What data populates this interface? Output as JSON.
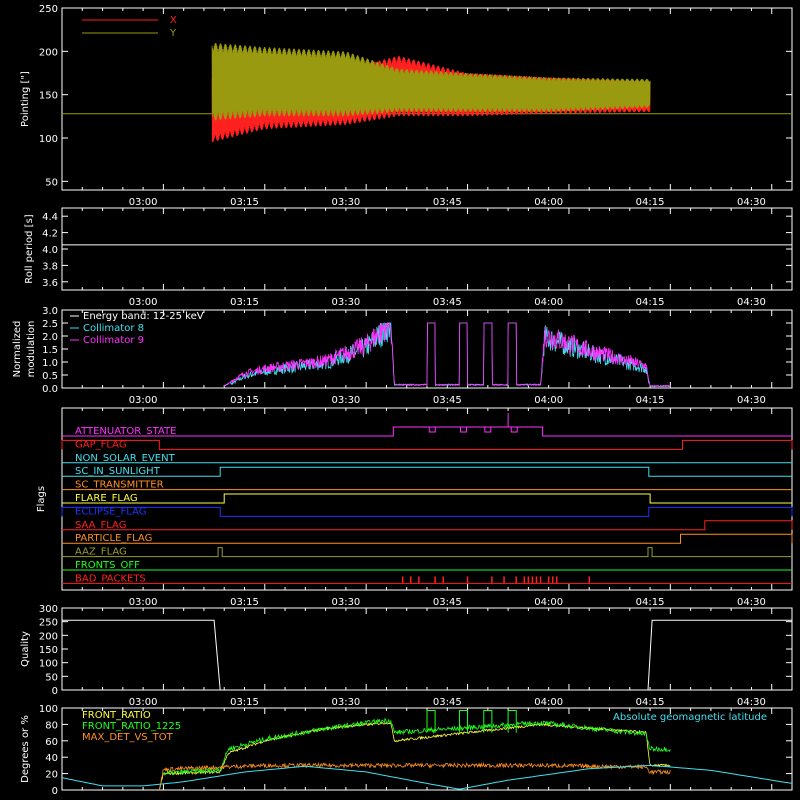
{
  "x_ticks": [
    "03:00",
    "03:15",
    "03:30",
    "03:45",
    "04:00",
    "04:15",
    "04:30"
  ],
  "colors": {
    "x": "#ff2020",
    "y": "#9a9a10",
    "white": "#ffffff",
    "cyan": "#40e0f0",
    "magenta": "#ff30ff",
    "yellow": "#ffff40",
    "green": "#20ff20",
    "orange": "#ff9020",
    "blue": "#2030ff",
    "olive": "#9a9a30"
  },
  "chart_data": [
    {
      "type": "line",
      "name": "pointing",
      "ylabel": "Pointing [\"]",
      "ylim": [
        40,
        250
      ],
      "yticks": [
        50,
        100,
        150,
        200,
        250
      ],
      "legend": [
        "X",
        "Y"
      ],
      "series": [
        {
          "name": "X",
          "oscillation": [
            [
              3.17,
              95,
              170
            ],
            [
              3.3,
              110,
              185
            ],
            [
              3.5,
              115,
              180
            ],
            [
              3.63,
              125,
              195
            ],
            [
              3.8,
              125,
              175
            ],
            [
              4.0,
              128,
              170
            ],
            [
              4.25,
              130,
              165
            ]
          ]
        },
        {
          "name": "Y",
          "oscillation": [
            [
              3.17,
              120,
              210
            ],
            [
              3.3,
              125,
              205
            ],
            [
              3.5,
              125,
              200
            ],
            [
              3.63,
              130,
              180
            ],
            [
              3.8,
              130,
              175
            ],
            [
              4.0,
              130,
              170
            ],
            [
              4.25,
              135,
              168
            ]
          ]
        }
      ],
      "reference_y": 128
    },
    {
      "type": "line",
      "name": "roll-period",
      "ylabel": "Roll period [s]",
      "ylim": [
        3.5,
        4.5
      ],
      "yticks": [
        "3.6",
        "3.8",
        "4.0",
        "4.2",
        "4.4"
      ],
      "series": [
        {
          "name": "",
          "value": 4.05
        }
      ]
    },
    {
      "type": "line",
      "name": "modulation",
      "ylabel_line1": "Normalized",
      "ylabel_line2": "modulation",
      "ylim": [
        0,
        3.0
      ],
      "yticks": [
        "0.0",
        "0.5",
        "1.0",
        "1.5",
        "2.0",
        "2.5",
        "3.0"
      ],
      "legend": [
        "Energy band: 12-25 keV",
        "Collimator 8",
        "Collimator 9"
      ],
      "level_points": [
        [
          3.2,
          0.05
        ],
        [
          3.25,
          0.5
        ],
        [
          3.3,
          0.7
        ],
        [
          3.45,
          1.0
        ],
        [
          3.55,
          1.6
        ],
        [
          3.61,
          2.5
        ],
        [
          3.62,
          0.1
        ],
        [
          3.98,
          0.1
        ],
        [
          3.99,
          2.0
        ],
        [
          4.1,
          1.4
        ],
        [
          4.24,
          0.8
        ],
        [
          4.25,
          0.05
        ],
        [
          4.3,
          0.05
        ]
      ],
      "spikes": [
        [
          3.7,
          3.72
        ],
        [
          3.78,
          3.8
        ],
        [
          3.84,
          3.86
        ],
        [
          3.9,
          3.92
        ]
      ]
    },
    {
      "type": "line",
      "name": "flags",
      "ylabel": "Flags",
      "flags": [
        {
          "name": "ATTENUATOR_STATE",
          "color": "magenta",
          "steps": [
            [
              3.617,
              3.985
            ]
          ],
          "notches": [
            3.713,
            3.79,
            3.85,
            3.915
          ],
          "spike": 3.9
        },
        {
          "name": "GAP_FLAG",
          "color": "x",
          "steps": [
            [
              2.8,
              3.04
            ],
            [
              4.33,
              4.6
            ]
          ]
        },
        {
          "name": "NON_SOLAR_EVENT",
          "color": "cyan",
          "steps": []
        },
        {
          "name": "SC_IN_SUNLIGHT",
          "color": "cyan",
          "steps": [
            [
              3.19,
              4.247
            ]
          ]
        },
        {
          "name": "SC_TRANSMITTER",
          "color": "orange",
          "steps": []
        },
        {
          "name": "FLARE_FLAG",
          "color": "yellow",
          "steps": [
            [
              3.2,
              4.25
            ]
          ]
        },
        {
          "name": "ECLIPSE_FLAG",
          "color": "blue",
          "steps": [
            [
              2.8,
              3.19
            ],
            [
              4.247,
              4.6
            ]
          ]
        },
        {
          "name": "SAA_FLAG",
          "color": "x",
          "steps": [
            [
              4.385,
              4.6
            ]
          ]
        },
        {
          "name": "PARTICLE_FLAG",
          "color": "orange",
          "steps": [
            [
              4.325,
              4.6
            ]
          ]
        },
        {
          "name": "AAZ_FLAG",
          "color": "olive",
          "steps": [
            [
              3.185,
              3.195
            ],
            [
              4.245,
              4.255
            ]
          ]
        },
        {
          "name": "FRONTS_OFF",
          "color": "green",
          "steps": []
        },
        {
          "name": "BAD_PACKETS",
          "color": "x",
          "steps": [],
          "ticks": [
            3.64,
            3.66,
            3.68,
            3.72,
            3.74,
            3.8,
            3.86,
            3.89,
            3.92,
            3.94,
            3.95,
            3.96,
            3.97,
            3.98,
            4.0,
            4.01,
            4.02,
            4.1
          ]
        }
      ]
    },
    {
      "type": "line",
      "name": "quality",
      "ylabel": "Quality",
      "ylim": [
        0,
        300
      ],
      "yticks": [
        "0",
        "50",
        "100",
        "150",
        "200",
        "250",
        "300"
      ],
      "series": [
        {
          "name": "",
          "steps": [
            [
              2.8,
              255
            ],
            [
              3.175,
              255
            ],
            [
              3.19,
              0
            ],
            [
              4.245,
              0
            ],
            [
              4.255,
              255
            ],
            [
              4.6,
              255
            ]
          ]
        }
      ]
    },
    {
      "type": "line",
      "name": "ratios",
      "ylabel": "Degrees or %",
      "ylim": [
        0,
        100
      ],
      "yticks": [
        "0",
        "20",
        "40",
        "60",
        "80",
        "100"
      ],
      "legend": [
        "FRONT_RATIO",
        "FRONT_RATIO_1225",
        "MAX_DET_VS_TOT",
        "Absolute geomagnetic latitude"
      ],
      "series": [
        {
          "name": "FRONT_RATIO",
          "points": [
            [
              3.04,
              0
            ],
            [
              3.05,
              20
            ],
            [
              3.19,
              22
            ],
            [
              3.21,
              45
            ],
            [
              3.3,
              60
            ],
            [
              3.45,
              75
            ],
            [
              3.6,
              82
            ],
            [
              3.61,
              82
            ],
            [
              3.62,
              60
            ],
            [
              3.98,
              80
            ],
            [
              4.24,
              70
            ],
            [
              4.25,
              30
            ],
            [
              4.3,
              30
            ]
          ]
        },
        {
          "name": "FRONT_RATIO_1225",
          "points": [
            [
              3.05,
              20
            ],
            [
              3.19,
              25
            ],
            [
              3.21,
              50
            ],
            [
              3.3,
              62
            ],
            [
              3.45,
              75
            ],
            [
              3.6,
              85
            ],
            [
              3.61,
              85
            ],
            [
              3.62,
              70
            ],
            [
              3.98,
              82
            ],
            [
              4.24,
              68
            ],
            [
              4.25,
              50
            ],
            [
              4.3,
              50
            ]
          ]
        },
        {
          "name": "MAX_DET_VS_TOT",
          "points": [
            [
              3.04,
              0
            ],
            [
              3.05,
              25
            ],
            [
              3.19,
              28
            ],
            [
              3.3,
              30
            ],
            [
              3.6,
              30
            ],
            [
              3.98,
              30
            ],
            [
              4.24,
              28
            ],
            [
              4.25,
              22
            ],
            [
              4.3,
              22
            ]
          ]
        },
        {
          "name": "Absolute geomagnetic latitude",
          "points": [
            [
              2.8,
              15
            ],
            [
              2.9,
              5
            ],
            [
              3.0,
              5
            ],
            [
              3.1,
              10
            ],
            [
              3.25,
              22
            ],
            [
              3.4,
              29
            ],
            [
              3.55,
              22
            ],
            [
              3.7,
              8
            ],
            [
              3.78,
              1
            ],
            [
              3.9,
              12
            ],
            [
              4.1,
              26
            ],
            [
              4.25,
              30
            ],
            [
              4.4,
              24
            ],
            [
              4.55,
              12
            ],
            [
              4.6,
              8
            ]
          ]
        }
      ]
    }
  ]
}
